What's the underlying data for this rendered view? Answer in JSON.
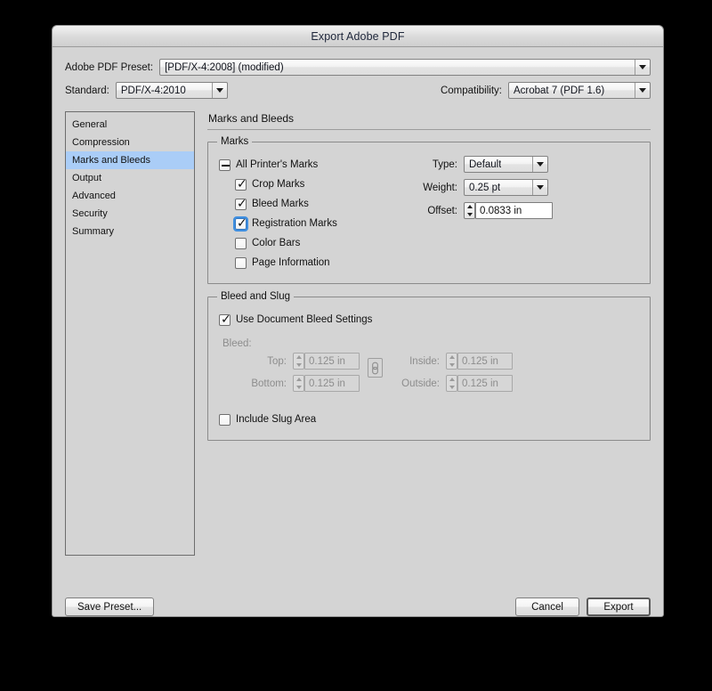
{
  "window": {
    "title": "Export Adobe PDF"
  },
  "top": {
    "preset_label": "Adobe PDF Preset:",
    "preset_value": "[PDF/X-4:2008] (modified)",
    "standard_label": "Standard:",
    "standard_value": "PDF/X-4:2010",
    "compatibility_label": "Compatibility:",
    "compatibility_value": "Acrobat 7 (PDF 1.6)"
  },
  "sidebar": {
    "items": [
      {
        "label": "General",
        "selected": false
      },
      {
        "label": "Compression",
        "selected": false
      },
      {
        "label": "Marks and Bleeds",
        "selected": true
      },
      {
        "label": "Output",
        "selected": false
      },
      {
        "label": "Advanced",
        "selected": false
      },
      {
        "label": "Security",
        "selected": false
      },
      {
        "label": "Summary",
        "selected": false
      }
    ]
  },
  "panel": {
    "title": "Marks and Bleeds",
    "marks_group": {
      "legend": "Marks",
      "all_printers_marks": {
        "label": "All Printer's Marks",
        "state": "mixed"
      },
      "checkboxes": [
        {
          "label": "Crop Marks",
          "checked": true,
          "focused": false
        },
        {
          "label": "Bleed Marks",
          "checked": true,
          "focused": false
        },
        {
          "label": "Registration Marks",
          "checked": true,
          "focused": true
        },
        {
          "label": "Color Bars",
          "checked": false,
          "focused": false
        },
        {
          "label": "Page Information",
          "checked": false,
          "focused": false
        }
      ],
      "type_label": "Type:",
      "type_value": "Default",
      "weight_label": "Weight:",
      "weight_value": "0.25 pt",
      "offset_label": "Offset:",
      "offset_value": "0.0833 in"
    },
    "bleed_group": {
      "legend": "Bleed and Slug",
      "use_document_bleed": {
        "label": "Use Document Bleed Settings",
        "checked": true
      },
      "bleed_label": "Bleed:",
      "fields": [
        {
          "label": "Top:",
          "value": "0.125 in",
          "disabled": true
        },
        {
          "label": "Bottom:",
          "value": "0.125 in",
          "disabled": true
        },
        {
          "label": "Inside:",
          "value": "0.125 in",
          "disabled": true
        },
        {
          "label": "Outside:",
          "value": "0.125 in",
          "disabled": true
        }
      ],
      "link_icon": "chain-link-icon",
      "include_slug": {
        "label": "Include Slug Area",
        "checked": false
      }
    }
  },
  "footer": {
    "save_preset_label": "Save Preset...",
    "cancel_label": "Cancel",
    "export_label": "Export"
  },
  "colors": {
    "window_bg": "#d4d4d4",
    "selection_blue": "#aacdf7",
    "focus_ring": "#3f8fe0",
    "desktop": "#000000"
  }
}
